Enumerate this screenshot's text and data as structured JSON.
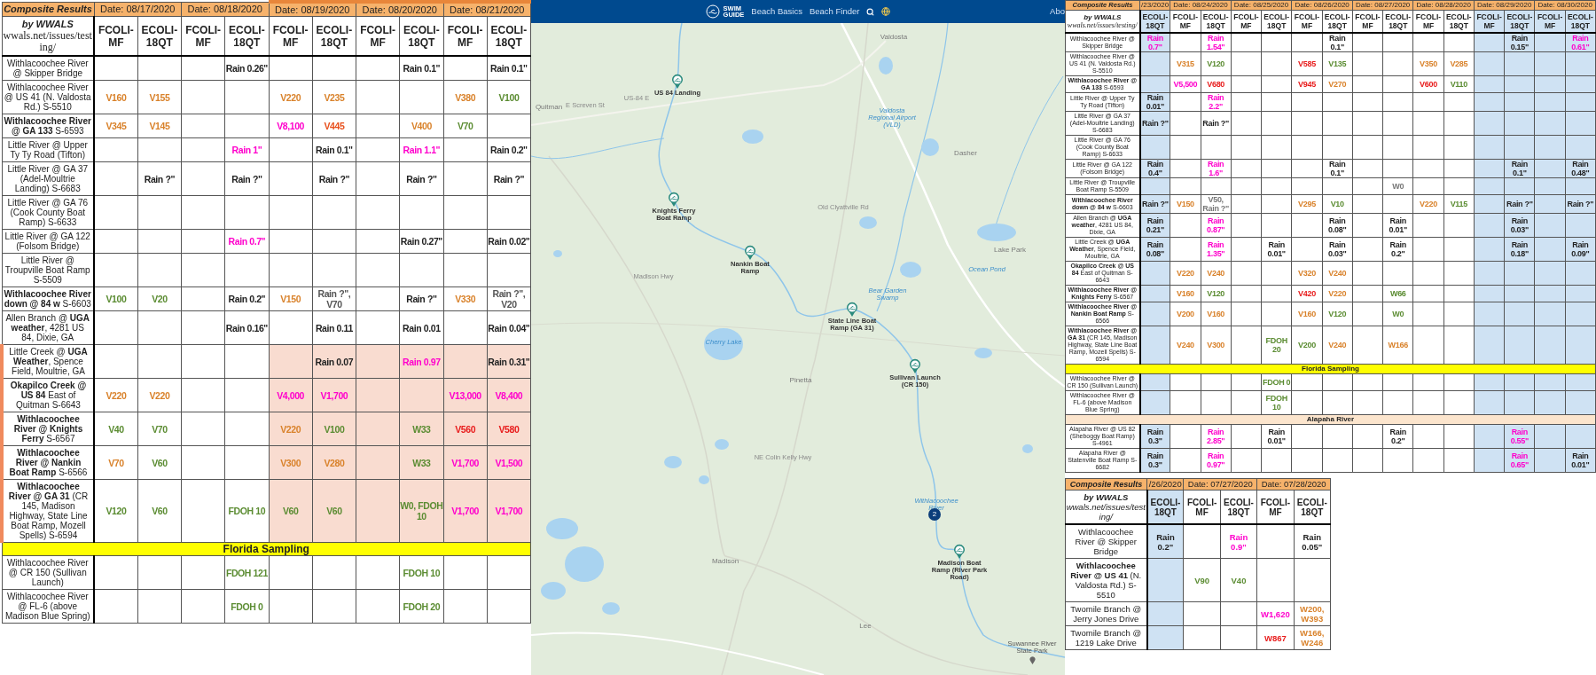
{
  "left_table": {
    "title": "Composite Results",
    "by": "by WWALS",
    "url": "wwals.net/issues/testing/",
    "dates": [
      {
        "label": "Date: 08/17/2020",
        "highlighted": false,
        "columns": [
          {
            "label": "FCOLI-MF"
          },
          {
            "label": "ECOLI-18QT"
          }
        ]
      },
      {
        "label": "Date: 08/18/2020",
        "highlighted": false,
        "columns": [
          {
            "label": "FCOLI-MF"
          },
          {
            "label": "ECOLI-18QT"
          }
        ]
      },
      {
        "label": "Date: 08/19/2020",
        "highlighted": true,
        "columns": [
          {
            "label": "FCOLI-MF"
          },
          {
            "label": "ECOLI-18QT"
          }
        ]
      },
      {
        "label": "Date: 08/20/2020",
        "highlighted": true,
        "columns": [
          {
            "label": "FCOLI-MF"
          },
          {
            "label": "ECOLI-18QT"
          }
        ]
      },
      {
        "label": "Date: 08/21/2020",
        "highlighted": true,
        "columns": [
          {
            "label": "FCOLI-MF"
          },
          {
            "label": "ECOLI-18QT"
          }
        ]
      }
    ],
    "rows": [
      {
        "kind": "site",
        "label": "Withlacoochee River @ Skipper Bridge",
        "highlighted": false,
        "cells": [
          {},
          {},
          {},
          {
            "text": "Rain 0.26\"",
            "color": "#222222"
          },
          {},
          {},
          {},
          {
            "text": "Rain 0.1\"",
            "color": "#222222"
          },
          {},
          {
            "text": "Rain 0.1\"",
            "color": "#222222"
          }
        ]
      },
      {
        "kind": "site",
        "label": "Withlacoochee River @ US 41 (N. Valdosta Rd.) S-5510",
        "highlighted": false,
        "cells": [
          {
            "text": "V160",
            "color": "#d9822b"
          },
          {
            "text": "V155",
            "color": "#d9822b"
          },
          {},
          {},
          {
            "text": "V220",
            "color": "#d9822b"
          },
          {
            "text": "V235",
            "color": "#d9822b"
          },
          {},
          {},
          {
            "text": "V380",
            "color": "#d9822b"
          },
          {
            "text": "V100",
            "color": "#5b8c32"
          }
        ]
      },
      {
        "kind": "site",
        "label": "**Withlacoochee River @ GA 133** S-6593",
        "highlighted": false,
        "cells": [
          {
            "text": "V345",
            "color": "#d9822b"
          },
          {
            "text": "V145",
            "color": "#d9822b"
          },
          {},
          {},
          {
            "text": "V8,100",
            "color": "#ff00cc"
          },
          {
            "text": "V445",
            "color": "#e8501c"
          },
          {},
          {
            "text": "V400",
            "color": "#d9822b"
          },
          {
            "text": "V70",
            "color": "#5b8c32"
          },
          {}
        ]
      },
      {
        "kind": "site",
        "label": "Little River @ Upper Ty Ty Road (Tifton)",
        "highlighted": false,
        "cells": [
          {},
          {},
          {},
          {
            "text": "Rain 1\"",
            "color": "#ff00cc"
          },
          {},
          {
            "text": "Rain 0.1\"",
            "color": "#222222"
          },
          {},
          {
            "text": "Rain 1.1\"",
            "color": "#ff00cc"
          },
          {},
          {
            "text": "Rain 0.2\"",
            "color": "#222222"
          }
        ]
      },
      {
        "kind": "site",
        "label": "Little River @ GA 37 (Adel-Moultrie Landing) S-6683",
        "highlighted": false,
        "cells": [
          {},
          {
            "text": "Rain ?\"",
            "color": "#222222"
          },
          {},
          {
            "text": "Rain ?\"",
            "color": "#222222"
          },
          {},
          {
            "text": "Rain ?\"",
            "color": "#222222"
          },
          {},
          {
            "text": "Rain ?\"",
            "color": "#222222"
          },
          {},
          {
            "text": "Rain ?\"",
            "color": "#222222"
          }
        ]
      },
      {
        "kind": "site",
        "label": "Little River @ GA 76 (Cook County Boat Ramp) S-6633",
        "highlighted": false,
        "cells": [
          {},
          {},
          {},
          {},
          {},
          {},
          {},
          {},
          {},
          {}
        ]
      },
      {
        "kind": "site",
        "label": "Little River @ GA 122 (Folsom Bridge)",
        "highlighted": false,
        "cells": [
          {},
          {},
          {},
          {
            "text": "Rain 0.7\"",
            "color": "#ff00cc"
          },
          {},
          {},
          {},
          {
            "text": "Rain 0.27\"",
            "color": "#222222"
          },
          {},
          {
            "text": "Rain 0.02\"",
            "color": "#222222"
          }
        ]
      },
      {
        "kind": "site",
        "label": "Little River @ Troupville Boat Ramp S-5509",
        "highlighted": false,
        "cells": [
          {},
          {},
          {},
          {},
          {},
          {},
          {},
          {},
          {},
          {}
        ]
      },
      {
        "kind": "site",
        "label": "**Withlacoochee River down @ 84 w** S-6603",
        "highlighted": false,
        "cells": [
          {
            "text": "V100",
            "color": "#5b8c32"
          },
          {
            "text": "V20",
            "color": "#5b8c32"
          },
          {},
          {
            "text": "Rain 0.2\"",
            "color": "#222222"
          },
          {
            "text": "V150",
            "color": "#d9822b"
          },
          {
            "text": "Rain ?\", V70",
            "color": "#555555"
          },
          {},
          {
            "text": "Rain ?\"",
            "color": "#222222"
          },
          {
            "text": "V330",
            "color": "#d9822b"
          },
          {
            "text": "Rain ?\", V20",
            "color": "#555555"
          }
        ]
      },
      {
        "kind": "site",
        "label": "Allen Branch @ **UGA weather**, 4281 US 84, Dixie, GA",
        "highlighted": false,
        "cells": [
          {},
          {},
          {},
          {
            "text": "Rain 0.16\"",
            "color": "#222222"
          },
          {},
          {
            "text": "Rain 0.11",
            "color": "#222222"
          },
          {},
          {
            "text": "Rain 0.01",
            "color": "#222222"
          },
          {},
          {
            "text": "Rain 0.04\"",
            "color": "#222222"
          }
        ]
      },
      {
        "kind": "site",
        "label": "Little Creek @ **UGA Weather**, Spence Field, Moultrie, GA",
        "highlighted": true,
        "cells": [
          {},
          {},
          {},
          {},
          {},
          {
            "text": "Rain 0.07",
            "color": "#222222"
          },
          {},
          {
            "text": "Rain 0.97",
            "color": "#ff00cc"
          },
          {},
          {
            "text": "Rain 0.31\"",
            "color": "#222222"
          }
        ]
      },
      {
        "kind": "site",
        "label": "**Okapilco Creek @ US 84** East of Quitman S-6643",
        "highlighted": true,
        "cells": [
          {
            "text": "V220",
            "color": "#d9822b"
          },
          {
            "text": "V220",
            "color": "#d9822b"
          },
          {},
          {},
          {
            "text": "V4,000",
            "color": "#ff00cc"
          },
          {
            "text": "V1,700",
            "color": "#ff00cc"
          },
          {},
          {},
          {
            "text": "V13,000",
            "color": "#ff00cc"
          },
          {
            "text": "V8,400",
            "color": "#ff00cc"
          }
        ]
      },
      {
        "kind": "site",
        "label": "**Withlacoochee River @ Knights Ferry** S-6567",
        "highlighted": true,
        "cells": [
          {
            "text": "V40",
            "color": "#5b8c32"
          },
          {
            "text": "V70",
            "color": "#5b8c32"
          },
          {},
          {},
          {
            "text": "V220",
            "color": "#d9822b"
          },
          {
            "text": "V100",
            "color": "#5b8c32"
          },
          {},
          {
            "text": "W33",
            "color": "#5b8c32"
          },
          {
            "text": "V560",
            "color": "#e81c1c"
          },
          {
            "text": "V580",
            "color": "#e81c1c"
          }
        ]
      },
      {
        "kind": "site",
        "label": "**Withlacoochee River @ Nankin Boat Ramp** S-6566",
        "highlighted": true,
        "cells": [
          {
            "text": "V70",
            "color": "#d9822b"
          },
          {
            "text": "V60",
            "color": "#5b8c32"
          },
          {},
          {},
          {
            "text": "V300",
            "color": "#d9822b"
          },
          {
            "text": "V280",
            "color": "#d9822b"
          },
          {},
          {
            "text": "W33",
            "color": "#5b8c32"
          },
          {
            "text": "V1,700",
            "color": "#ff00cc"
          },
          {
            "text": "V1,500",
            "color": "#ff00cc"
          }
        ]
      },
      {
        "kind": "site",
        "label": "**Withlacoochee River @ GA 31** (CR 145, Madison Highway, State Line Boat Ramp, Mozell Spells) S-6594",
        "highlighted": true,
        "cells": [
          {
            "text": "V120",
            "color": "#5b8c32"
          },
          {
            "text": "V60",
            "color": "#5b8c32"
          },
          {},
          {
            "text": "FDOH 10",
            "color": "#5b8c32"
          },
          {
            "text": "V60",
            "color": "#5b8c32"
          },
          {
            "text": "V60",
            "color": "#5b8c32"
          },
          {},
          {
            "text": "W0, FDOH 10",
            "color": "#5b8c32"
          },
          {
            "text": "V1,700",
            "color": "#ff00cc"
          },
          {
            "text": "V1,700",
            "color": "#ff00cc"
          }
        ]
      },
      {
        "kind": "section",
        "label": "Florida Sampling",
        "color": "#ffff00"
      },
      {
        "kind": "site",
        "label": "Withlacoochee River @ CR 150 (Sullivan Launch)",
        "highlighted": false,
        "cells": [
          {},
          {},
          {},
          {
            "text": "FDOH 121",
            "color": "#5b8c32"
          },
          {},
          {},
          {},
          {
            "text": "FDOH 10",
            "color": "#5b8c32"
          },
          {},
          {}
        ]
      },
      {
        "kind": "site",
        "label": "Withlacoochee River @ FL-6 (above Madison Blue Spring)",
        "highlighted": false,
        "cells": [
          {},
          {},
          {},
          {
            "text": "FDOH 0",
            "color": "#5b8c32"
          },
          {},
          {},
          {},
          {
            "text": "FDOH 20",
            "color": "#5b8c32"
          },
          {},
          {}
        ]
      }
    ]
  },
  "map": {
    "header": {
      "logo": [
        "SWIM",
        "GUIDE"
      ],
      "nav": [
        "Beach Basics",
        "Beach Finder"
      ],
      "nav_cut": "Abo"
    },
    "places": [
      {
        "label": "Valdosta",
        "kind": "town"
      },
      {
        "label": "Quitman",
        "kind": "town"
      },
      {
        "label": "US-84 E",
        "kind": "road"
      },
      {
        "label": "E Screven St",
        "kind": "road"
      },
      {
        "label": "Valdosta Regional Airport (VLD)",
        "kind": "water"
      },
      {
        "label": "Dasher",
        "kind": "town"
      },
      {
        "label": "Lake Park",
        "kind": "town"
      },
      {
        "label": "Bear Garden Swamp",
        "kind": "water"
      },
      {
        "label": "Ocean Pond",
        "kind": "water"
      },
      {
        "label": "Madison Hwy",
        "kind": "road"
      },
      {
        "label": "Old Clyattville Rd",
        "kind": "road"
      },
      {
        "label": "Cherry Lake",
        "kind": "water"
      },
      {
        "label": "Pinetta",
        "kind": "town"
      },
      {
        "label": "NE Colin Kelly Hwy",
        "kind": "road"
      },
      {
        "label": "Withlacoochee River",
        "kind": "water"
      },
      {
        "label": "Madison",
        "kind": "town"
      },
      {
        "label": "Lee",
        "kind": "town"
      },
      {
        "label": "Suwannee River State Park",
        "kind": "park"
      }
    ],
    "markers": [
      "US 84 Landing",
      "Knights Ferry Boat Ramp",
      "Nankin Boat Ramp",
      "State Line Boat Ramp (GA 31)",
      "Sullivan Launch (CR 150)",
      "Madison Boat Ramp (River Park Road)"
    ],
    "cluster": "2"
  },
  "right_table": {
    "title": "Composite Results",
    "by": "by WWALS",
    "url": "wwals.net/issues/testing/",
    "dates": [
      {
        "label": "/23/2020",
        "columns": [
          {
            "label": "ECOLI-18QT",
            "shaded": true
          }
        ]
      },
      {
        "label": "Date: 08/24/2020",
        "columns": [
          {
            "label": "FCOLI-MF",
            "shaded": false
          },
          {
            "label": "ECOLI-18QT",
            "shaded": false
          }
        ]
      },
      {
        "label": "Date: 08/25/2020",
        "columns": [
          {
            "label": "FCOLI-MF",
            "shaded": false
          },
          {
            "label": "ECOLI-18QT",
            "shaded": false
          }
        ]
      },
      {
        "label": "Date: 08/26/2020",
        "columns": [
          {
            "label": "FCOLI-MF",
            "shaded": false
          },
          {
            "label": "ECOLI-18QT",
            "shaded": false
          }
        ]
      },
      {
        "label": "Date: 08/27/2020",
        "columns": [
          {
            "label": "FCOLI-MF",
            "shaded": false
          },
          {
            "label": "ECOLI-18QT",
            "shaded": false
          }
        ]
      },
      {
        "label": "Date: 08/28/2020",
        "columns": [
          {
            "label": "FCOLI-MF",
            "shaded": false
          },
          {
            "label": "ECOLI-18QT",
            "shaded": false
          }
        ]
      },
      {
        "label": "Date: 08/29/2020",
        "columns": [
          {
            "label": "FCOLI-MF",
            "shaded": true
          },
          {
            "label": "ECOLI-18QT",
            "shaded": true
          }
        ]
      },
      {
        "label": "Date: 08/30/2020",
        "columns": [
          {
            "label": "FCOLI-MF",
            "shaded": true
          },
          {
            "label": "ECOLI-18QT",
            "shaded": true
          }
        ]
      }
    ],
    "rows": [
      {
        "kind": "site",
        "label": "Withlacoochee River @ Skipper Bridge",
        "cells": [
          {
            "text": "Rain 0.7\"",
            "color": "#ff00cc"
          },
          {},
          {
            "text": "Rain 1.54\"",
            "color": "#ff00cc"
          },
          {},
          {},
          {},
          {
            "text": "Rain 0.1\"",
            "color": "#222222"
          },
          {},
          {},
          {},
          {},
          {},
          {
            "text": "Rain 0.15\"",
            "color": "#222222"
          },
          {},
          {
            "text": "Rain 0.61\"",
            "color": "#ff00cc"
          }
        ]
      },
      {
        "kind": "site",
        "label": "Withlacoochee River @ US 41 (N. Valdosta Rd.) S-5510",
        "cells": [
          {},
          {
            "text": "V315",
            "color": "#d9822b"
          },
          {
            "text": "V120",
            "color": "#5b8c32"
          },
          {},
          {},
          {
            "text": "V585",
            "color": "#e81c1c"
          },
          {
            "text": "V135",
            "color": "#5b8c32"
          },
          {},
          {},
          {
            "text": "V350",
            "color": "#d9822b"
          },
          {
            "text": "V285",
            "color": "#d9822b"
          },
          {},
          {},
          {},
          {}
        ]
      },
      {
        "kind": "site",
        "label": "**Withlacoochee River @ GA 133** S-6593",
        "cells": [
          {},
          {
            "text": "V5,500",
            "color": "#ff00cc"
          },
          {
            "text": "V680",
            "color": "#e81c1c"
          },
          {},
          {},
          {
            "text": "V945",
            "color": "#e81c1c"
          },
          {
            "text": "V270",
            "color": "#d9822b"
          },
          {},
          {},
          {
            "text": "V600",
            "color": "#e81c1c"
          },
          {
            "text": "V110",
            "color": "#5b8c32"
          },
          {},
          {},
          {},
          {}
        ]
      },
      {
        "kind": "site",
        "label": "Little River @ Upper Ty Ty Road (Tifton)",
        "cells": [
          {
            "text": "Rain 0.01\"",
            "color": "#222222"
          },
          {},
          {
            "text": "Rain 2.2\"",
            "color": "#ff00cc"
          },
          {},
          {},
          {},
          {},
          {},
          {},
          {},
          {},
          {},
          {},
          {},
          {}
        ]
      },
      {
        "kind": "site",
        "label": "Little River @ GA 37 (Adel-Moultrie Landing) S-6683",
        "cells": [
          {
            "text": "Rain ?\"",
            "color": "#222222"
          },
          {},
          {
            "text": "Rain ?\"",
            "color": "#222222"
          },
          {},
          {},
          {},
          {},
          {},
          {},
          {},
          {},
          {},
          {},
          {},
          {}
        ]
      },
      {
        "kind": "site",
        "label": "Little River @ GA 76 (Cook County Boat Ramp) S-6633",
        "cells": [
          {},
          {},
          {},
          {},
          {},
          {},
          {},
          {},
          {},
          {},
          {},
          {},
          {},
          {},
          {}
        ]
      },
      {
        "kind": "site",
        "label": "Little River @ GA 122 (Folsom Bridge)",
        "cells": [
          {
            "text": "Rain 0.4\"",
            "color": "#222222"
          },
          {},
          {
            "text": "Rain 1.6\"",
            "color": "#ff00cc"
          },
          {},
          {},
          {},
          {
            "text": "Rain 0.1\"",
            "color": "#222222"
          },
          {},
          {},
          {},
          {},
          {},
          {
            "text": "Rain 0.1\"",
            "color": "#222222"
          },
          {},
          {
            "text": "Rain 0.48\"",
            "color": "#222222"
          }
        ]
      },
      {
        "kind": "site",
        "label": "Little River @ Troupville Boat Ramp S-5509",
        "cells": [
          {},
          {},
          {},
          {},
          {},
          {},
          {},
          {},
          {
            "text": "W0",
            "color": "#777777"
          },
          {},
          {},
          {},
          {},
          {},
          {}
        ]
      },
      {
        "kind": "site",
        "label": "**Withlacoochee River down @ 84 w** S-6603",
        "cells": [
          {
            "text": "Rain ?\"",
            "color": "#222222"
          },
          {
            "text": "V150",
            "color": "#d9822b"
          },
          {
            "text": "V50, Rain ?\"",
            "color": "#777777"
          },
          {},
          {},
          {
            "text": "V295",
            "color": "#d9822b"
          },
          {
            "text": "V10",
            "color": "#5b8c32"
          },
          {},
          {},
          {
            "text": "V220",
            "color": "#d9822b"
          },
          {
            "text": "V115",
            "color": "#5b8c32"
          },
          {},
          {
            "text": "Rain ?\"",
            "color": "#222222"
          },
          {},
          {
            "text": "Rain ?\"",
            "color": "#222222"
          }
        ]
      },
      {
        "kind": "site",
        "label": "Allen Branch @ **UGA weather**, 4281 US 84, Dixie, GA",
        "cells": [
          {
            "text": "Rain 0.21\"",
            "color": "#222222"
          },
          {},
          {
            "text": "Rain 0.87\"",
            "color": "#ff00cc"
          },
          {},
          {},
          {},
          {
            "text": "Rain 0.08\"",
            "color": "#222222"
          },
          {},
          {
            "text": "Rain 0.01\"",
            "color": "#222222"
          },
          {},
          {},
          {},
          {
            "text": "Rain 0.03\"",
            "color": "#222222"
          },
          {},
          {}
        ]
      },
      {
        "kind": "site",
        "label": "Little Creek @ **UGA Weather**, Spence Field, Moultrie, GA",
        "cells": [
          {
            "text": "Rain 0.08\"",
            "color": "#222222"
          },
          {},
          {
            "text": "Rain 1.35\"",
            "color": "#ff00cc"
          },
          {},
          {
            "text": "Rain 0.01\"",
            "color": "#222222"
          },
          {},
          {
            "text": "Rain 0.03\"",
            "color": "#222222"
          },
          {},
          {
            "text": "Rain 0.2\"",
            "color": "#222222"
          },
          {},
          {},
          {},
          {
            "text": "Rain 0.18\"",
            "color": "#222222"
          },
          {},
          {
            "text": "Rain 0.09\"",
            "color": "#222222"
          }
        ]
      },
      {
        "kind": "site",
        "label": "**Okapilco Creek @ US 84** East of Quitman S-6643",
        "cells": [
          {},
          {
            "text": "V220",
            "color": "#d9822b"
          },
          {
            "text": "V240",
            "color": "#d9822b"
          },
          {},
          {},
          {
            "text": "V320",
            "color": "#d9822b"
          },
          {
            "text": "V240",
            "color": "#d9822b"
          },
          {},
          {},
          {},
          {},
          {},
          {},
          {},
          {}
        ]
      },
      {
        "kind": "site",
        "label": "**Withlacoochee River @ Knights Ferry** S-6567",
        "cells": [
          {},
          {
            "text": "V160",
            "color": "#d9822b"
          },
          {
            "text": "V120",
            "color": "#5b8c32"
          },
          {},
          {},
          {
            "text": "V420",
            "color": "#e81c1c"
          },
          {
            "text": "V220",
            "color": "#d9822b"
          },
          {},
          {
            "text": "W66",
            "color": "#5b8c32"
          },
          {},
          {},
          {},
          {},
          {},
          {}
        ]
      },
      {
        "kind": "site",
        "label": "**Withlacoochee River @ Nankin Boat Ramp** S-6566",
        "cells": [
          {},
          {
            "text": "V200",
            "color": "#d9822b"
          },
          {
            "text": "V160",
            "color": "#d9822b"
          },
          {},
          {},
          {
            "text": "V160",
            "color": "#d9822b"
          },
          {
            "text": "V120",
            "color": "#5b8c32"
          },
          {},
          {
            "text": "W0",
            "color": "#5b8c32"
          },
          {},
          {},
          {},
          {},
          {},
          {}
        ]
      },
      {
        "kind": "site",
        "label": "**Withlacoochee River @ GA 31** (CR 145, Madison Highway, State Line Boat Ramp, Mozell Spells) S-6594",
        "cells": [
          {},
          {
            "text": "V240",
            "color": "#d9822b"
          },
          {
            "text": "V300",
            "color": "#d9822b"
          },
          {},
          {
            "text": "FDOH 20",
            "color": "#5b8c32"
          },
          {
            "text": "V200",
            "color": "#5b8c32"
          },
          {
            "text": "V240",
            "color": "#d9822b"
          },
          {},
          {
            "text": "W166",
            "color": "#d9822b"
          },
          {},
          {},
          {},
          {},
          {},
          {}
        ]
      },
      {
        "kind": "section",
        "label": "Florida Sampling",
        "color": "#ffff00"
      },
      {
        "kind": "site",
        "label": "Withlacoochee River @ CR 150 (Sullivan Launch)",
        "cells": [
          {},
          {},
          {},
          {},
          {
            "text": "FDOH 0",
            "color": "#5b8c32"
          },
          {},
          {},
          {},
          {},
          {},
          {},
          {},
          {},
          {},
          {}
        ]
      },
      {
        "kind": "site",
        "label": "Withlacoochee River @ FL-6 (above Madison Blue Spring)",
        "cells": [
          {},
          {},
          {},
          {},
          {
            "text": "FDOH 10",
            "color": "#5b8c32"
          },
          {},
          {},
          {},
          {},
          {},
          {},
          {},
          {},
          {},
          {}
        ]
      },
      {
        "kind": "section",
        "label": "Alapaha River",
        "color": "#fce5cd"
      },
      {
        "kind": "site",
        "label": "Alapaha River @ US 82 (Sheboggy Boat Ramp) S-4961",
        "cells": [
          {
            "text": "Rain 0.3\"",
            "color": "#222222"
          },
          {},
          {
            "text": "Rain 2.85\"",
            "color": "#ff00cc"
          },
          {},
          {
            "text": "Rain 0.01\"",
            "color": "#222222"
          },
          {},
          {},
          {},
          {
            "text": "Rain 0.2\"",
            "color": "#222222"
          },
          {},
          {},
          {},
          {
            "text": "Rain 0.55\"",
            "color": "#ff00cc"
          },
          {},
          {}
        ]
      },
      {
        "kind": "site",
        "label": "Alapaha River @ Statenville Boat Ramp S-6682",
        "cells": [
          {
            "text": "Rain 0.3\"",
            "color": "#222222"
          },
          {},
          {
            "text": "Rain 0.97\"",
            "color": "#ff00cc"
          },
          {},
          {},
          {},
          {},
          {},
          {},
          {},
          {},
          {},
          {
            "text": "Rain 0.65\"",
            "color": "#ff00cc"
          },
          {},
          {
            "text": "Rain 0.01\"",
            "color": "#222222"
          }
        ]
      }
    ]
  },
  "bottom_table": {
    "title": "Composite Results",
    "by": "by WWALS",
    "url": "wwals.net/issues/testing/",
    "dates": [
      {
        "label": "/26/2020",
        "columns": [
          {
            "label": "ECOLI-18QT",
            "shaded": true
          }
        ]
      },
      {
        "label": "Date: 07/27/2020",
        "columns": [
          {
            "label": "FCOLI-MF",
            "shaded": false
          },
          {
            "label": "ECOLI-18QT",
            "shaded": false
          }
        ]
      },
      {
        "label": "Date: 07/28/2020",
        "columns": [
          {
            "label": "FCOLI-MF",
            "shaded": false
          },
          {
            "label": "ECOLI-18QT",
            "shaded": false
          }
        ]
      }
    ],
    "rows": [
      {
        "kind": "site",
        "label": "Withlacoochee River @ Skipper Bridge",
        "cells": [
          {
            "text": "Rain 0.2\"",
            "color": "#222222"
          },
          {},
          {
            "text": "Rain 0.9\"",
            "color": "#ff00cc"
          },
          {},
          {
            "text": "Rain 0.05\"",
            "color": "#222222"
          }
        ]
      },
      {
        "kind": "site",
        "label": "**Withlacoochee River @ US 41** (N. Valdosta Rd.) S-5510",
        "cells": [
          {},
          {
            "text": "V90",
            "color": "#5b8c32"
          },
          {
            "text": "V40",
            "color": "#5b8c32"
          },
          {},
          {}
        ]
      },
      {
        "kind": "site",
        "label": "Twomile Branch @ Jerry Jones Drive",
        "cells": [
          {},
          {},
          {},
          {
            "text": "W1,620",
            "color": "#ff00cc"
          },
          {
            "text": "W200, W393",
            "color": "#d9822b"
          }
        ]
      },
      {
        "kind": "site",
        "label": "Twomile Branch @ 1219 Lake Drive",
        "cells": [
          {},
          {},
          {},
          {
            "text": "W867",
            "color": "#e81c1c"
          },
          {
            "text": "W166, W246",
            "color": "#d9822b"
          }
        ]
      }
    ]
  }
}
